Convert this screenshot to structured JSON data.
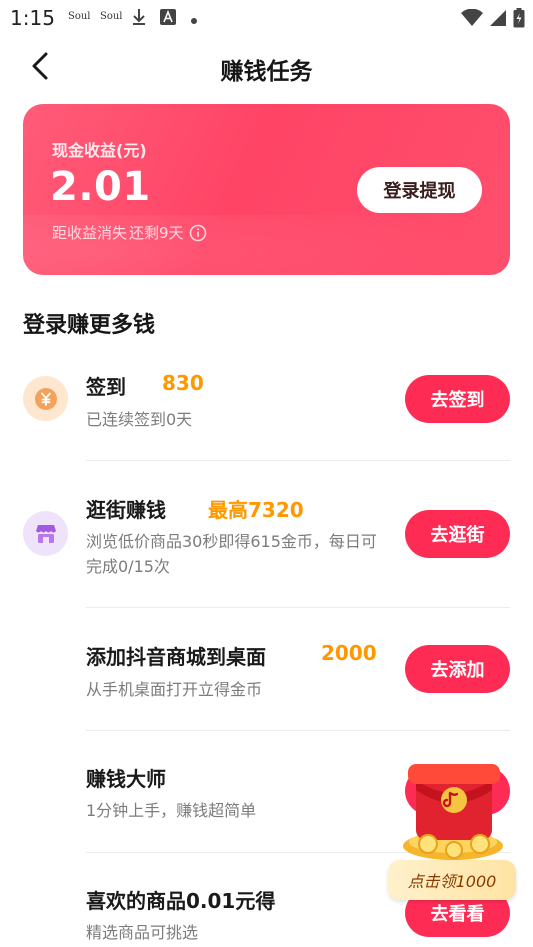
{
  "status_bar": {
    "time": "1:15",
    "apps": [
      "Soul",
      "Soul"
    ],
    "icons": [
      "download-icon",
      "font-icon",
      "dot-icon",
      "wifi-icon",
      "signal-icon",
      "battery-icon"
    ]
  },
  "nav": {
    "back_icon": "chevron-left-icon",
    "title": "赚钱任务"
  },
  "earnings": {
    "label": "现金收益(元)",
    "amount": "2.01",
    "expire_prefix": "距收益消失",
    "expire_remaining": "还剩9天",
    "info_icon": "info-icon",
    "withdraw_label": "登录提现",
    "gradient": [
      "#ff5b78",
      "#ff4466"
    ]
  },
  "section": {
    "title": "登录赚更多钱"
  },
  "tasks": [
    {
      "name": "签到",
      "reward": "830",
      "desc": "已连续签到0天",
      "button": "去签到",
      "icon": "coin-icon"
    },
    {
      "name": "逛街赚钱",
      "reward": "最高7320",
      "desc": "浏览低价商品30秒即得615金币，每日可完成0/15次",
      "button": "去逛街",
      "icon": "shop-icon"
    },
    {
      "name": "添加抖音商城到桌面",
      "reward": "2000",
      "desc": "从手机桌面打开立得金币",
      "button": "去添加"
    },
    {
      "name": "赚钱大师",
      "desc": "1分钟上手，赚钱超简单"
    },
    {
      "name": "喜欢的商品0.01元得",
      "desc": "精选商品可挑选",
      "button": "去看看"
    }
  ],
  "promo": {
    "label": "点击领1000",
    "icon": "red-envelope-icon"
  },
  "colors": {
    "accent": "#fe2c55",
    "reward": "#ff9800",
    "coin_bg": "#ffe6cf",
    "shop_bg": "#efe3fb"
  }
}
